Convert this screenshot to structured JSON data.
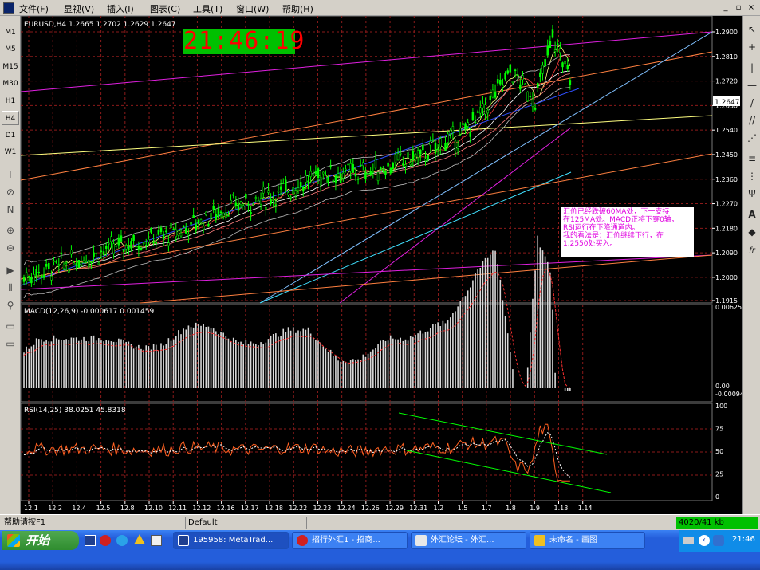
{
  "menubar": {
    "items": [
      "文件(F)",
      "显视(V)",
      "插入(I)",
      "图表(C)",
      "工具(T)",
      "窗口(W)",
      "帮助(H)"
    ],
    "window_buttons": [
      "_",
      "▫",
      "×"
    ]
  },
  "timeframes": [
    "M1",
    "M5",
    "M15",
    "M30",
    "H1",
    "H4",
    "D1",
    "W1"
  ],
  "left_tools": [
    "⟊",
    "⊘",
    "N",
    "⊕",
    "⊖",
    "▶",
    "⫴",
    "⚲",
    "▭",
    "▭"
  ],
  "right_tools": [
    "↖",
    "+",
    "|",
    "—",
    "/",
    "//",
    "⋰",
    "≡",
    "⋮",
    "Ψ",
    "A",
    "◆",
    "fr"
  ],
  "chart": {
    "symbol_line": "EURUSD,H4  1.2665 1.2702 1.2629 1.2647",
    "clock": "21:46:19",
    "current_price": "1.2647",
    "price_ticks": [
      "1.2900",
      "1.2810",
      "1.2720",
      "1.2630",
      "1.2540",
      "1.2450",
      "1.2360",
      "1.2270",
      "1.2180",
      "1.2090",
      "1.2000",
      "1.1915"
    ],
    "macd_label": "MACD(12,26,9)  -0.000617  0.001459",
    "macd_ticks": [
      "0.00625",
      "0.00",
      "-0.00094"
    ],
    "rsi_label": "RSI(14,25)  38.0251  45.8318",
    "rsi_ticks": [
      "100",
      "75",
      "50",
      "25",
      "0"
    ],
    "date_ticks": [
      "12.1",
      "12.2",
      "12.4",
      "12.5",
      "12.8",
      "12.10",
      "12.11",
      "12.12",
      "12.16",
      "12.17",
      "12.18",
      "12.22",
      "12.23",
      "12.24",
      "12.26",
      "12.29",
      "12.31",
      "1.2",
      "1.5",
      "1.7",
      "1.8",
      "1.9",
      "1.13",
      "1.14"
    ],
    "annotation": [
      "汇价已经跌破60MA处，下一支持",
      "在125MA处。MACD正将下穿0轴，",
      "RSI运行在下降通道内。",
      "我的看法是：汇价继续下行，在",
      "1.2550处买入。"
    ],
    "colors": {
      "background": "#000000",
      "grid": "#8b1a1a",
      "candle": "#00ff00",
      "clock": "#ff0000",
      "clock_bg": "#00c000",
      "annotation": "#e000e0",
      "rsi_channel": "#00ff00"
    }
  },
  "statusbar": {
    "help": "帮助请按F1",
    "profile": "Default",
    "traffic": "4020/41 kb"
  },
  "taskbar": {
    "start": "开始",
    "buttons": [
      "195958: MetaTrad...",
      "招行外汇1 - 招商...",
      "外汇论坛 - 外汇...",
      "未命名 - 画图"
    ],
    "time": "21:46"
  }
}
